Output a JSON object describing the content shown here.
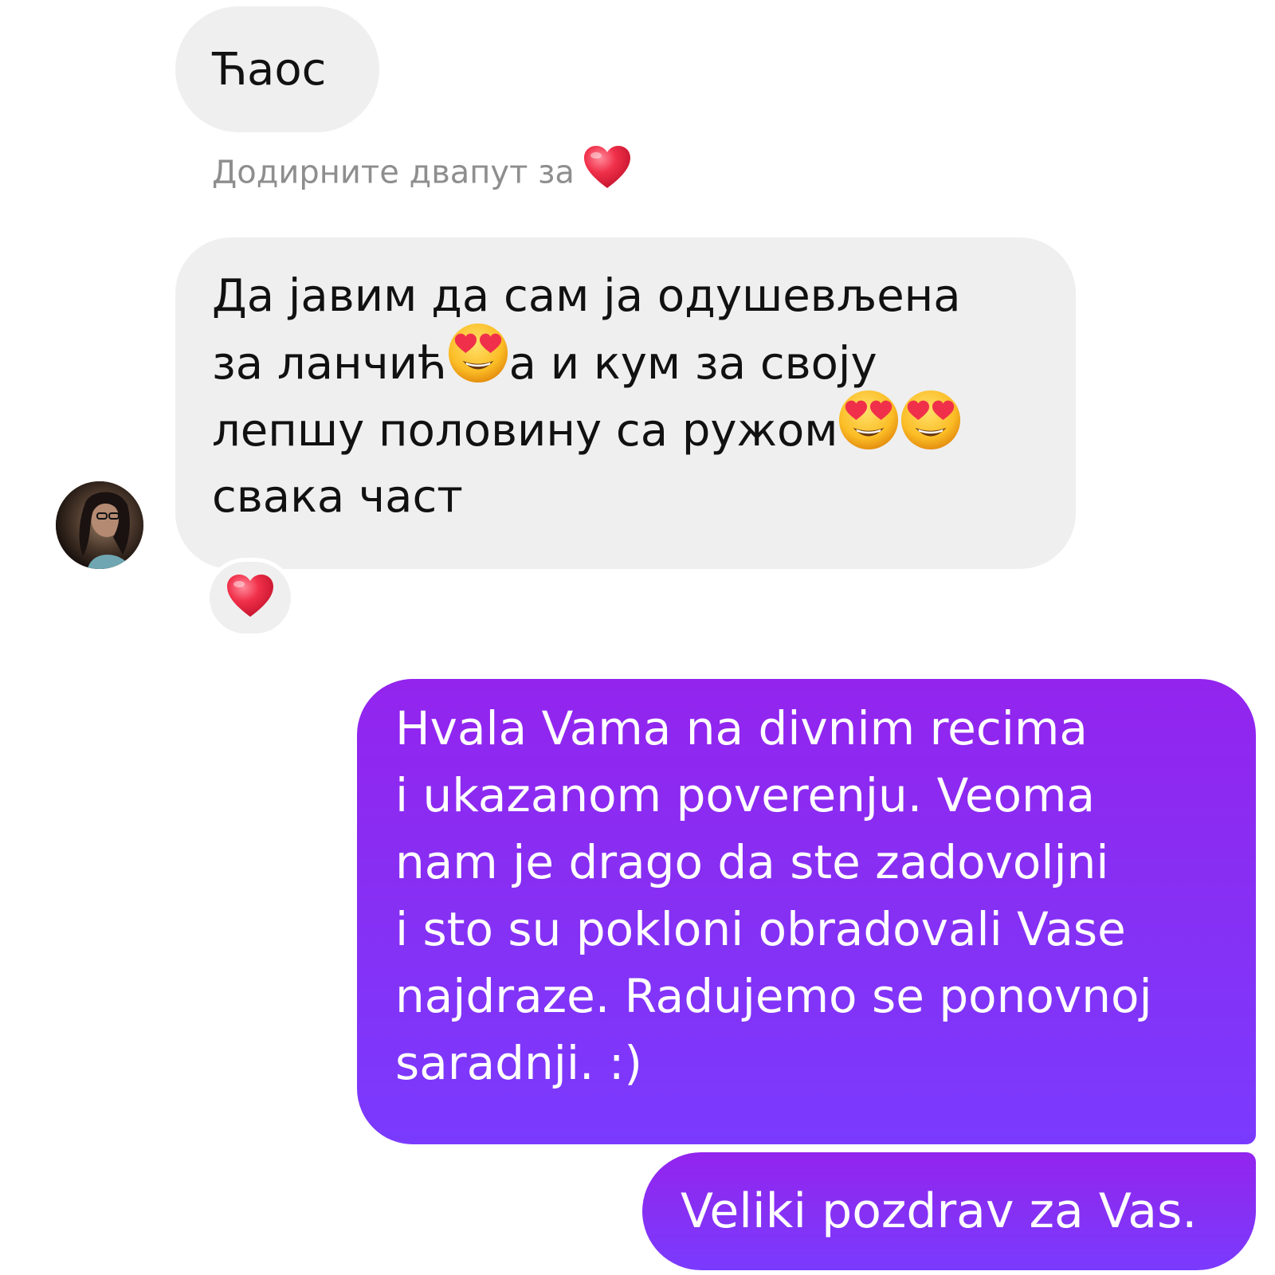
{
  "messages": {
    "incoming_1": "Ћаос",
    "hint": "Додирните двапут за",
    "incoming_2": {
      "line_1": "Да јавим да сам ја одушевљена",
      "line_2a": "за ланчић",
      "line_2b": "а и кум за своју",
      "line_3": "лепшу половину са ружом",
      "line_4": "свака част"
    },
    "outgoing_1": {
      "line_1": "Hvala Vama na divnim recima",
      "line_2": "i ukazanom poverenju. Veoma",
      "line_3": "nam je drago da ste zadovoljni",
      "line_4": "i sto su pokloni obradovali Vase",
      "line_5": "najdraze. Radujemo se ponovnoj",
      "line_6": "saradnji. :)"
    },
    "outgoing_2": "Veliki pozdrav za Vas."
  },
  "reaction": "heart",
  "icons": {
    "hint_icon": "heart-icon",
    "emoji": "heart-eyes-emoji",
    "reaction_icon": "heart-icon"
  },
  "colors": {
    "incoming_bubble": "#efefef",
    "outgoing_top": "#9324ee",
    "outgoing_bottom": "#7a3afe",
    "hint_text": "#8e8e8e",
    "heart": "#f0304a"
  }
}
